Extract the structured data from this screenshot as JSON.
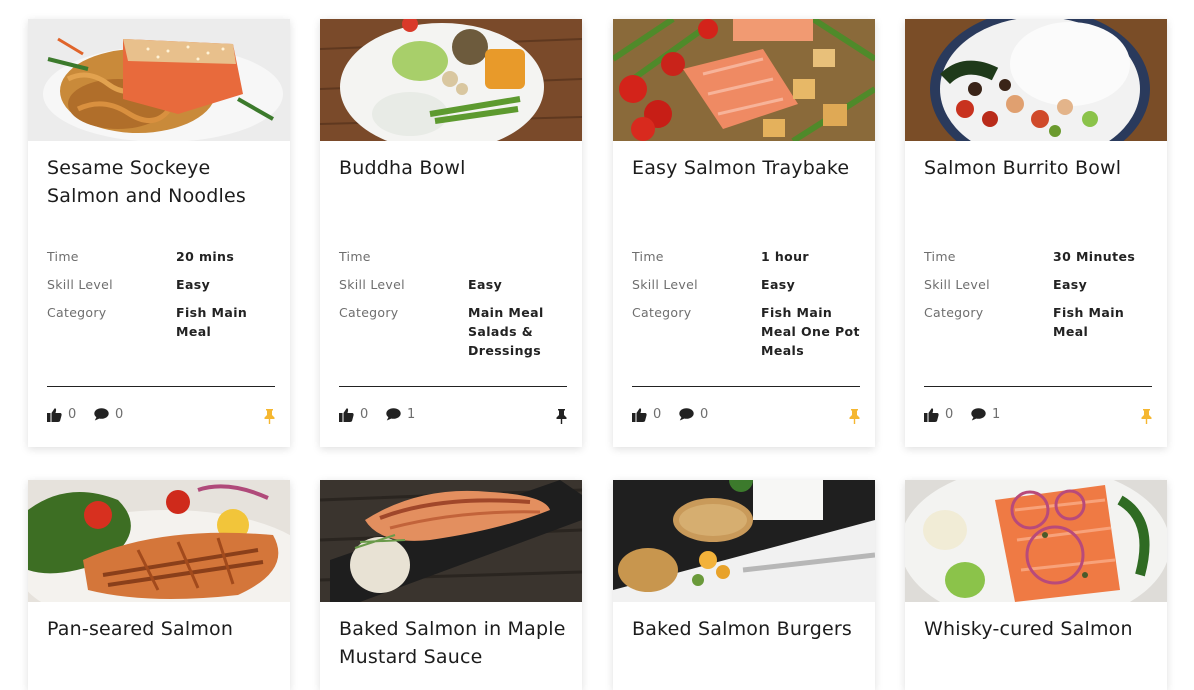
{
  "labels": {
    "time": "Time",
    "skill": "Skill Level",
    "category": "Category"
  },
  "colors": {
    "pin_active": "#f5b731",
    "pin_inactive": "#222222"
  },
  "cards": [
    {
      "title": "Sesame Sockeye Salmon and Noodles",
      "time": "20 mins",
      "skill": "Easy",
      "category": "Fish Main Meal",
      "likes": "0",
      "comments": "0",
      "pin": "highlighted"
    },
    {
      "title": "Buddha Bowl",
      "time": "",
      "skill": "Easy",
      "category": "Main Meal Salads & Dressings",
      "likes": "0",
      "comments": "1",
      "pin": "dark"
    },
    {
      "title": "Easy Salmon Traybake",
      "time": "1 hour",
      "skill": "Easy",
      "category": "Fish Main Meal One Pot Meals",
      "likes": "0",
      "comments": "0",
      "pin": "highlighted"
    },
    {
      "title": "Salmon Burrito Bowl",
      "time": "30 Minutes",
      "skill": "Easy",
      "category": "Fish Main Meal",
      "likes": "0",
      "comments": "1",
      "pin": "highlighted"
    },
    {
      "title": "Pan-seared Salmon"
    },
    {
      "title": "Baked Salmon in Maple Mustard Sauce"
    },
    {
      "title": "Baked Salmon Burgers"
    },
    {
      "title": "Whisky-cured Salmon"
    }
  ]
}
